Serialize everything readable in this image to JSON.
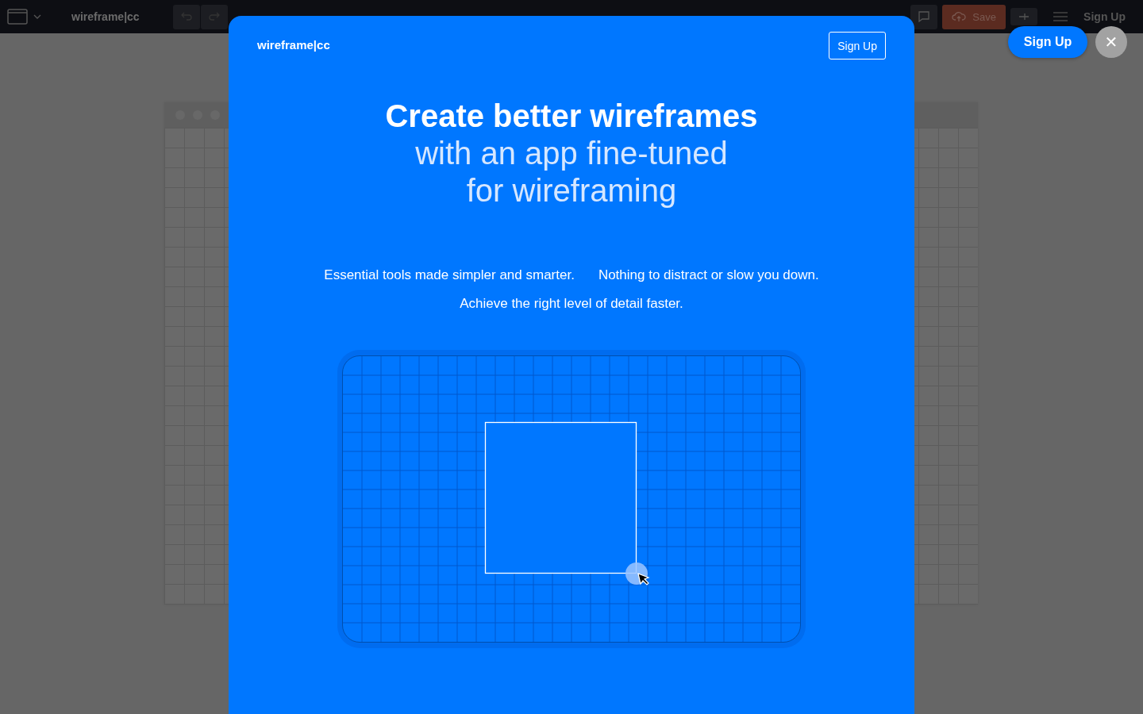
{
  "app_bar": {
    "logo": "wireframe|cc",
    "save_label": "Save",
    "signup_label": "Sign Up"
  },
  "modal": {
    "logo": "wireframe|cc",
    "signup_label": "Sign Up",
    "headline_bold": "Create better wireframes",
    "headline_lines": [
      "with an app fine-tuned",
      "for wireframing"
    ],
    "features": [
      "Essential tools made simpler and smarter.",
      "Nothing to distract or slow you down.",
      "Achieve the right level of detail faster."
    ]
  },
  "floating_signup_label": "Sign Up",
  "close_label": "✕"
}
